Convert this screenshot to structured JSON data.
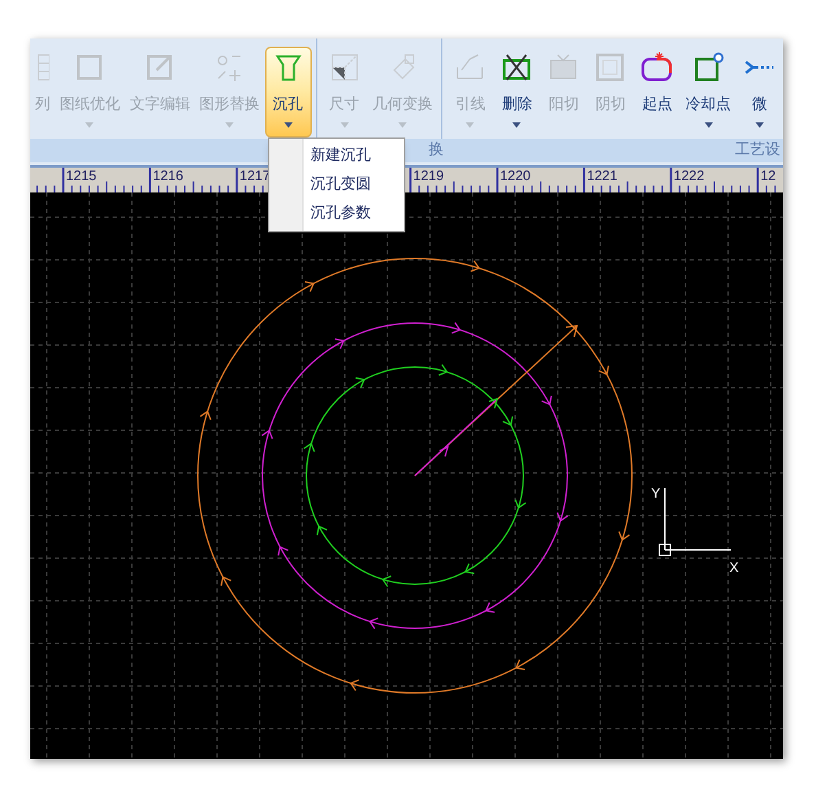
{
  "ribbon": {
    "buttons": [
      {
        "label": "列",
        "disabled": true,
        "dropdown": false
      },
      {
        "label": "图纸优化",
        "disabled": true,
        "dropdown": true
      },
      {
        "label": "文字编辑",
        "disabled": true,
        "dropdown": false
      },
      {
        "label": "图形替换",
        "disabled": true,
        "dropdown": true
      },
      {
        "label": "沉孔",
        "disabled": false,
        "dropdown": true,
        "selected": true
      },
      {
        "label": "尺寸",
        "disabled": true,
        "dropdown": true
      },
      {
        "label": "几何变换",
        "disabled": true,
        "dropdown": true
      },
      {
        "label": "引线",
        "disabled": true,
        "dropdown": true
      },
      {
        "label": "删除",
        "disabled": false,
        "dropdown": true
      },
      {
        "label": "阳切",
        "disabled": true,
        "dropdown": false
      },
      {
        "label": "阴切",
        "disabled": true,
        "dropdown": false
      },
      {
        "label": "起点",
        "disabled": false,
        "dropdown": false
      },
      {
        "label": "冷却点",
        "disabled": false,
        "dropdown": true
      },
      {
        "label": "微",
        "disabled": false,
        "dropdown": true
      }
    ],
    "groups": [
      "换",
      "工艺设"
    ]
  },
  "menu": {
    "items": [
      "新建沉孔",
      "沉孔变圆",
      "沉孔参数"
    ]
  },
  "ruler": {
    "labels": [
      "1215",
      "1216",
      "1217",
      "1219",
      "1220",
      "1221",
      "1222",
      "12"
    ]
  },
  "canvas": {
    "circles": [
      {
        "color": "#e07a28"
      },
      {
        "color": "#d020d0"
      },
      {
        "color": "#20d020"
      }
    ],
    "axis_labels": [
      "Y",
      "X"
    ]
  }
}
